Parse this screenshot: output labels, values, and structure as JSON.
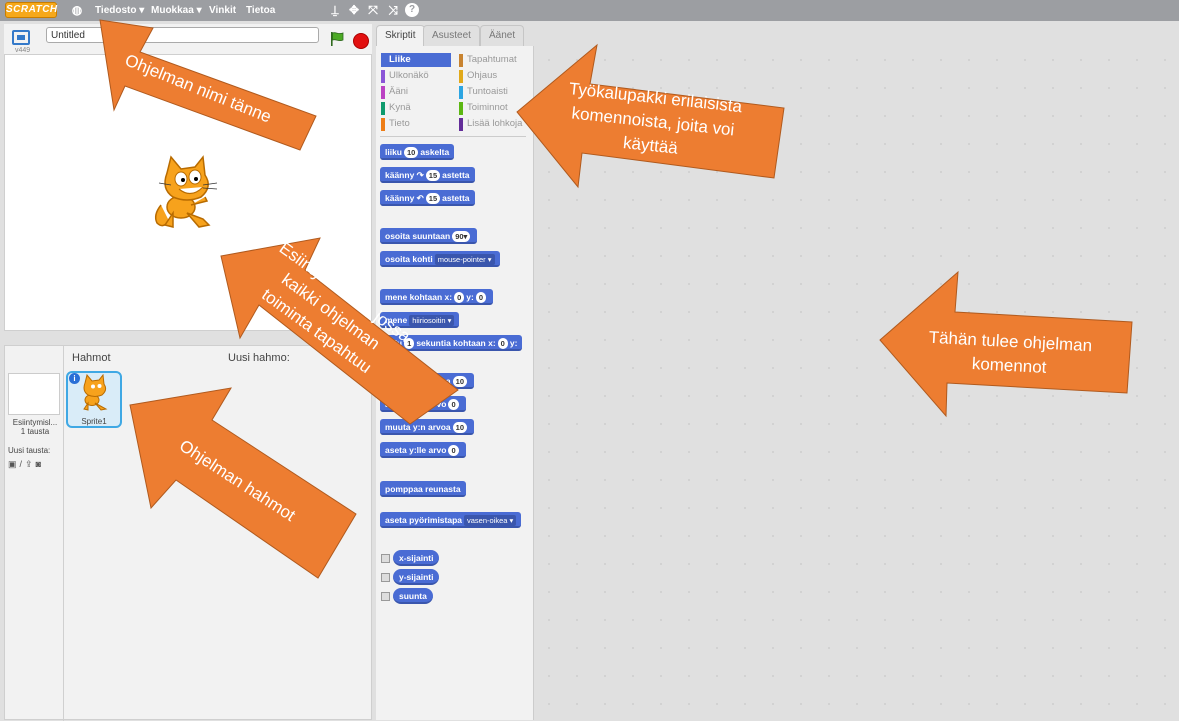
{
  "menubar": {
    "logo": "SCRATCH",
    "items": [
      "Tiedosto ▾",
      "Muokkaa ▾",
      "Vinkit",
      "Tietoa"
    ],
    "tool_icons": [
      "globe-icon",
      "stamp-icon",
      "grow-icon",
      "expand-icon",
      "shrink-icon",
      "help-icon"
    ]
  },
  "stage": {
    "version": "v449",
    "project_title": "Untitled"
  },
  "sprites_pane": {
    "header": "Hahmot",
    "new_sprite": "Uusi hahmo:",
    "stage_name": "Esiintymisl...",
    "stage_backdrops": "1 tausta",
    "new_backdrop": "Uusi tausta:",
    "sprite_name": "Sprite1"
  },
  "tabs": [
    "Skriptit",
    "Asusteet",
    "Äänet"
  ],
  "categories_left": [
    {
      "label": "Liike",
      "color": "#4a6cd4"
    },
    {
      "label": "Ulkonäkö",
      "color": "#8a55d7"
    },
    {
      "label": "Ääni",
      "color": "#bb42c3"
    },
    {
      "label": "Kynä",
      "color": "#0e9a6c"
    },
    {
      "label": "Tieto",
      "color": "#ee7d16"
    }
  ],
  "categories_right": [
    {
      "label": "Tapahtumat",
      "color": "#c88330"
    },
    {
      "label": "Ohjaus",
      "color": "#e1a91a"
    },
    {
      "label": "Tuntoaisti",
      "color": "#2ca5e2"
    },
    {
      "label": "Toiminnot",
      "color": "#5cb712"
    },
    {
      "label": "Lisää lohkoja",
      "color": "#632d99"
    }
  ],
  "blocks": {
    "b1a": "liiku",
    "b1n": "10",
    "b1b": "askelta",
    "b2a": "käänny ↷",
    "b2n": "15",
    "b2b": "astetta",
    "b3a": "käänny ↶",
    "b3n": "15",
    "b3b": "astetta",
    "b4a": "osoita suuntaan",
    "b4d": "90▾",
    "b5a": "osoita kohti",
    "b5d": "mouse-pointer ▾",
    "b6a": "mene kohtaan x:",
    "b6n1": "0",
    "b6b": "y:",
    "b6n2": "0",
    "b7a": "mene",
    "b7d": "hiiriosoitin ▾",
    "b8a": "liu'u",
    "b8n1": "1",
    "b8b": "sekuntia kohtaan x:",
    "b8n2": "0",
    "b8c": "y:",
    "b9a": "muuta x:n arvoa",
    "b9n": "10",
    "b10a": "aseta x:lle arvo",
    "b10n": "0",
    "b11a": "muuta y:n arvoa",
    "b11n": "10",
    "b12a": "aseta y:lle arvo",
    "b12n": "0",
    "b13a": "pomppaa reunasta",
    "b14a": "aseta pyörimistapa",
    "b14d": "vasen-oikea ▾",
    "r1": "x-sijainti",
    "r2": "y-sijainti",
    "r3": "suunta"
  },
  "annotations": {
    "a1": "Ohjelman nimi tänne",
    "a2_l1": "Työkalupakki erilaisista",
    "a2_l2": "komennoista, joita voi",
    "a2_l3": "käyttää",
    "a3_l1": "Esiintymislava, jossa",
    "a3_l2": "kaikki ohjelman",
    "a3_l3": "toiminta tapahtuu",
    "a4": "Ohjelman hahmot",
    "a5_l1": "Tähän tulee ohjelman",
    "a5_l2": "komennot"
  },
  "colors": {
    "accent": "#ed7d31",
    "motion": "#4a6cd4"
  }
}
